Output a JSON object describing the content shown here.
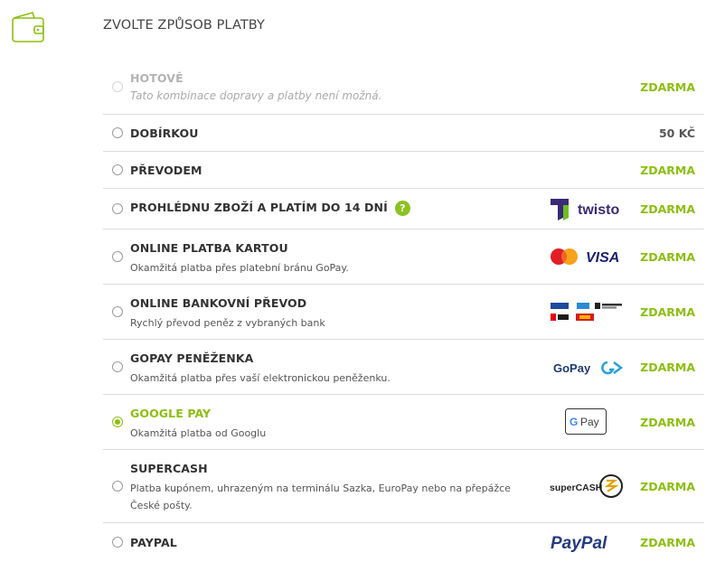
{
  "section_title": "ZVOLTE ZPŮSOB PLATBY",
  "colors": {
    "accent": "#8cbf0f",
    "divider": "#dcdcdc"
  },
  "icons": {
    "header": "wallet-icon"
  },
  "methods": [
    {
      "name": "HOTOVĚ",
      "description": "Tato kombinace dopravy a platby není možná.",
      "price": "ZDARMA",
      "state": "disabled"
    },
    {
      "name": "DOBÍRKOU",
      "price": "50 KČ"
    },
    {
      "name": "PŘEVODEM",
      "price": "ZDARMA"
    },
    {
      "name": "PROHLÉDNU ZBOŽÍ A PLATÍM DO 14 DNÍ",
      "help": "?",
      "logo": "twisto",
      "logo_text": "twisto",
      "price": "ZDARMA"
    },
    {
      "name": "ONLINE PLATBA KARTOU",
      "description": "Okamžitá platba přes platební bránu GoPay.",
      "logo": "mastercard-visa",
      "logo_text": "VISA",
      "price": "ZDARMA"
    },
    {
      "name": "ONLINE BANKOVNÍ PŘEVOD",
      "description": "Rychlý převod peněz z vybraných bank",
      "logo": "bank-logos",
      "price": "ZDARMA"
    },
    {
      "name": "GOPAY PENĚŽENKA",
      "description": "Okamžitá platba přes vaší elektronickou peněženku.",
      "logo": "gopay",
      "logo_text": "GoPay",
      "price": "ZDARMA"
    },
    {
      "name": "GOOGLE PAY",
      "description": "Okamžitá platba od Googlu",
      "logo": "google-pay",
      "logo_text": "Pay",
      "price": "ZDARMA",
      "state": "selected"
    },
    {
      "name": "SUPERCASH",
      "description": "Platba kupónem, uhrazeným na terminálu Sazka, EuroPay nebo na přepážce České pošty.",
      "logo": "supercash",
      "logo_text": "superCASH",
      "price": "ZDARMA"
    },
    {
      "name": "PAYPAL",
      "logo": "paypal",
      "logo_text": "PayPal",
      "price": "ZDARMA"
    }
  ]
}
